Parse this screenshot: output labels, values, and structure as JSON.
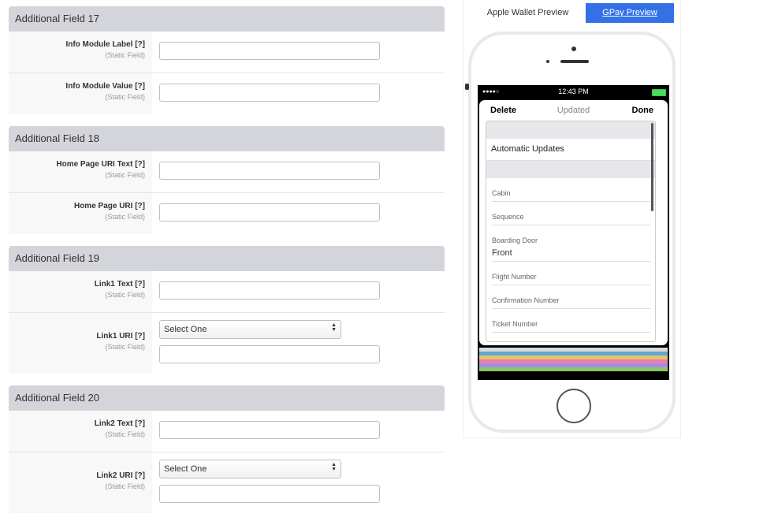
{
  "sections": [
    {
      "title": "Additional Field 17",
      "rows": [
        {
          "label": "Info Module Label",
          "help": "[?]",
          "sub": "(Static Field)",
          "type": "text"
        },
        {
          "label": "Info Module Value",
          "help": "[?]",
          "sub": "(Static Field)",
          "type": "text"
        }
      ]
    },
    {
      "title": "Additional Field 18",
      "rows": [
        {
          "label": "Home Page URI Text",
          "help": "[?]",
          "sub": "(Static Field)",
          "type": "text"
        },
        {
          "label": "Home Page URI",
          "help": "[?]",
          "sub": "(Static Field)",
          "type": "text"
        }
      ]
    },
    {
      "title": "Additional Field 19",
      "rows": [
        {
          "label": "Link1 Text",
          "help": "[?]",
          "sub": "(Static Field)",
          "type": "text"
        },
        {
          "label": "Link1 URI",
          "help": "[?]",
          "sub": "(Static Field)",
          "type": "select",
          "select": "Select One"
        }
      ]
    },
    {
      "title": "Additional Field 20",
      "rows": [
        {
          "label": "Link2 Text",
          "help": "[?]",
          "sub": "(Static Field)",
          "type": "text"
        },
        {
          "label": "Link2 URI",
          "help": "[?]",
          "sub": "(Static Field)",
          "type": "select",
          "select": "Select One"
        }
      ]
    }
  ],
  "preview": {
    "tabs": {
      "apple": "Apple Wallet Preview",
      "gpay": "GPay Preview"
    },
    "status": {
      "dots": "●●●●○",
      "time": "12:43 PM"
    },
    "card": {
      "delete": "Delete",
      "updated": "Updated",
      "done": "Done"
    },
    "automatic_updates": "Automatic Updates",
    "fields": [
      {
        "label": "Cabin",
        "value": ""
      },
      {
        "label": "Sequence",
        "value": ""
      },
      {
        "label": "Boarding Door",
        "value": "Front"
      },
      {
        "label": "Flight Number",
        "value": ""
      },
      {
        "label": "Confirmation Number",
        "value": ""
      },
      {
        "label": "Ticket Number",
        "value": ""
      }
    ],
    "stripe_colors": [
      "#d9d9d9",
      "#5fa8d3",
      "#e8c26b",
      "#e77fb0",
      "#a88be0",
      "#8ac76a"
    ]
  },
  "colors": {
    "accent": "#3471e6",
    "section_header": "#d4d5da"
  }
}
